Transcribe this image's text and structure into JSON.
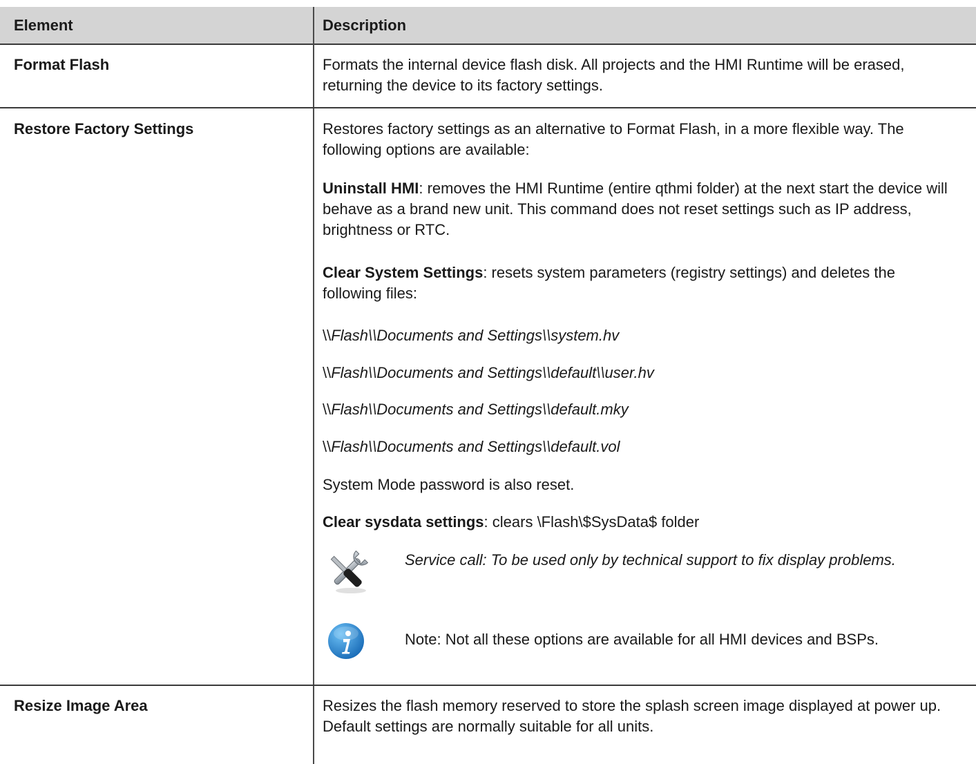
{
  "table": {
    "headers": {
      "element": "Element",
      "description": "Description"
    },
    "rows": [
      {
        "element": "Format Flash",
        "description": "Formats the internal device flash disk. All projects and the HMI Runtime will be erased, returning the device to its factory settings."
      },
      {
        "element": "Restore Factory Settings",
        "intro": "Restores factory settings as an alternative to Format Flash, in a more flexible way. The following options are available:",
        "uninstall_label": "Uninstall HMI",
        "uninstall_text": ": removes the HMI Runtime (entire qthmi folder) at the next start the device will behave as a brand new unit. This command does not reset settings such as IP address, brightness or RTC.",
        "clear_sys_label": "Clear System Settings",
        "clear_sys_text": ": resets system parameters (registry settings) and deletes the following files:",
        "files": [
          {
            "parts": [
              "\\\\",
              "Flash",
              "\\\\",
              "Documents and Settings",
              "\\\\",
              "system.hv"
            ]
          },
          {
            "parts": [
              "\\\\",
              "Flash",
              "\\\\",
              "Documents and Settings",
              "\\\\",
              "default",
              "\\\\",
              "user.hv"
            ]
          },
          {
            "parts": [
              "\\\\",
              "Flash",
              "\\\\",
              "Documents and Settings",
              "\\\\",
              "default.mky"
            ]
          },
          {
            "parts": [
              "\\\\",
              "Flash",
              "\\\\",
              "Documents and Settings",
              "\\\\",
              "default.vol"
            ]
          }
        ],
        "password_reset": "System Mode password is also reset.",
        "sysdata_label": "Clear sysdata settings",
        "sysdata_text": ": clears \\Flash\\$SysData$ folder",
        "service_note": "Service call: To be used only by technical support to fix display problems.",
        "info_note": "Note: Not all these options are available for all HMI devices and BSPs.",
        "icons": {
          "service": "tools-icon",
          "info": "info-icon"
        }
      },
      {
        "element": "Resize Image Area",
        "description": "Resizes the flash memory reserved to store the splash screen image displayed at power up. Default settings are normally suitable for all units."
      }
    ]
  },
  "colors": {
    "header_bg": "#d4d4d4",
    "rule": "#3a3a3a",
    "info_blue": "#1f7fcf"
  }
}
